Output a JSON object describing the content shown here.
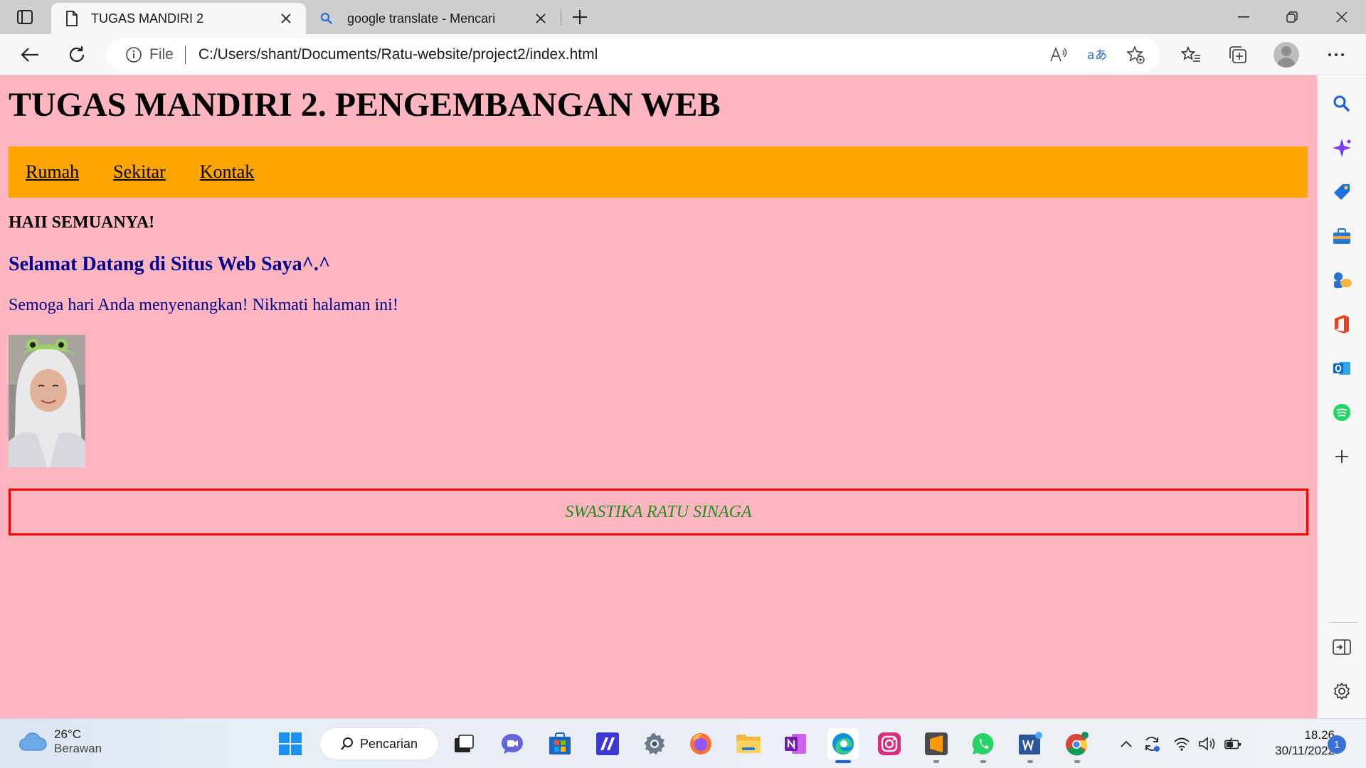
{
  "browser": {
    "tabs": [
      {
        "title": "TUGAS MANDIRI 2",
        "active": true,
        "icon": "document-icon"
      },
      {
        "title": "google translate - Mencari",
        "active": false,
        "icon": "search-icon"
      }
    ],
    "address": {
      "scheme_label": "File",
      "url": "C:/Users/shant/Documents/Ratu-website/project2/index.html"
    }
  },
  "page": {
    "title": "TUGAS MANDIRI 2. PENGEMBANGAN WEB",
    "nav": [
      "Rumah",
      "Sekitar",
      "Kontak"
    ],
    "greeting": "HAII SEMUANYA!",
    "welcome": "Selamat Datang di Situs Web Saya^.^",
    "subtext": "Semoga hari Anda menyenangkan! Nikmati halaman ini!",
    "footer": "SWASTIKA RATU SINAGA",
    "colors": {
      "background": "#ffb6c1",
      "nav_bg": "#ffa500",
      "heading_blue": "#00008b",
      "footer_border": "#ff0000",
      "footer_text": "#228b22"
    }
  },
  "sidebar": {
    "icons": [
      "search-icon",
      "copilot-icon",
      "shopping-tag-icon",
      "tools-icon",
      "games-icon",
      "office-icon",
      "outlook-icon",
      "spotify-icon",
      "add-icon",
      "hide-sidebar-icon",
      "settings-icon"
    ]
  },
  "taskbar": {
    "weather": {
      "temp": "26°C",
      "condition": "Berawan"
    },
    "search_label": "Pencarian",
    "clock": {
      "time": "18.26",
      "date": "30/11/2022"
    },
    "notifications": "1"
  }
}
